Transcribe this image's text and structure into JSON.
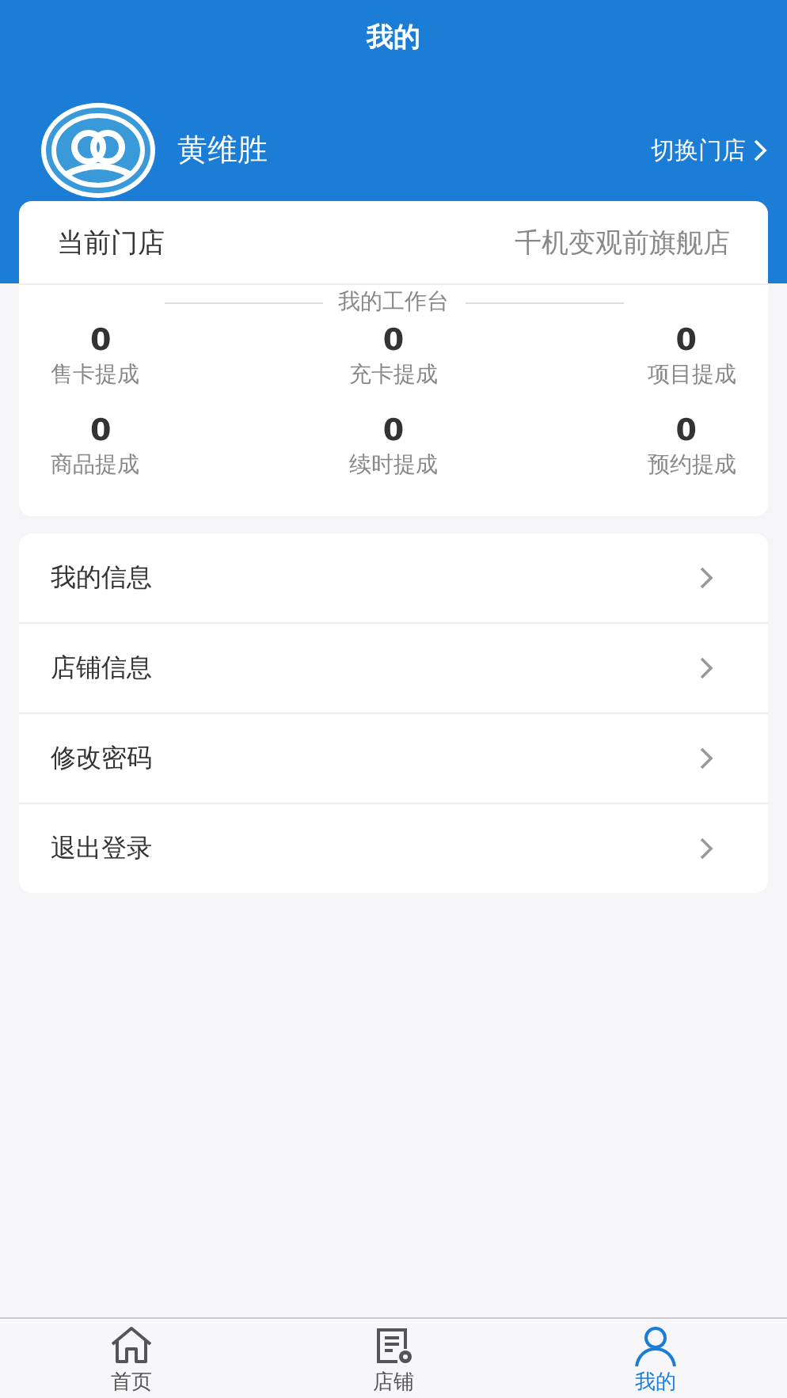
{
  "title": "我的",
  "profile": {
    "name": "黄维胜",
    "switch_label": "切换门店"
  },
  "store": {
    "label": "当前门店",
    "value": "千机变观前旗舰店"
  },
  "workbench": {
    "title": "我的工作台",
    "stats": [
      {
        "value": "0",
        "label": "售卡提成"
      },
      {
        "value": "0",
        "label": "充卡提成"
      },
      {
        "value": "0",
        "label": "项目提成"
      },
      {
        "value": "0",
        "label": "商品提成"
      },
      {
        "value": "0",
        "label": "续时提成"
      },
      {
        "value": "0",
        "label": "预约提成"
      }
    ]
  },
  "menu": [
    {
      "label": "我的信息"
    },
    {
      "label": "店铺信息"
    },
    {
      "label": "修改密码"
    },
    {
      "label": "退出登录"
    }
  ],
  "tabs": [
    {
      "label": "首页",
      "kind": "home",
      "selected": false
    },
    {
      "label": "店铺",
      "kind": "store",
      "selected": false
    },
    {
      "label": "我的",
      "kind": "user",
      "selected": true
    }
  ]
}
